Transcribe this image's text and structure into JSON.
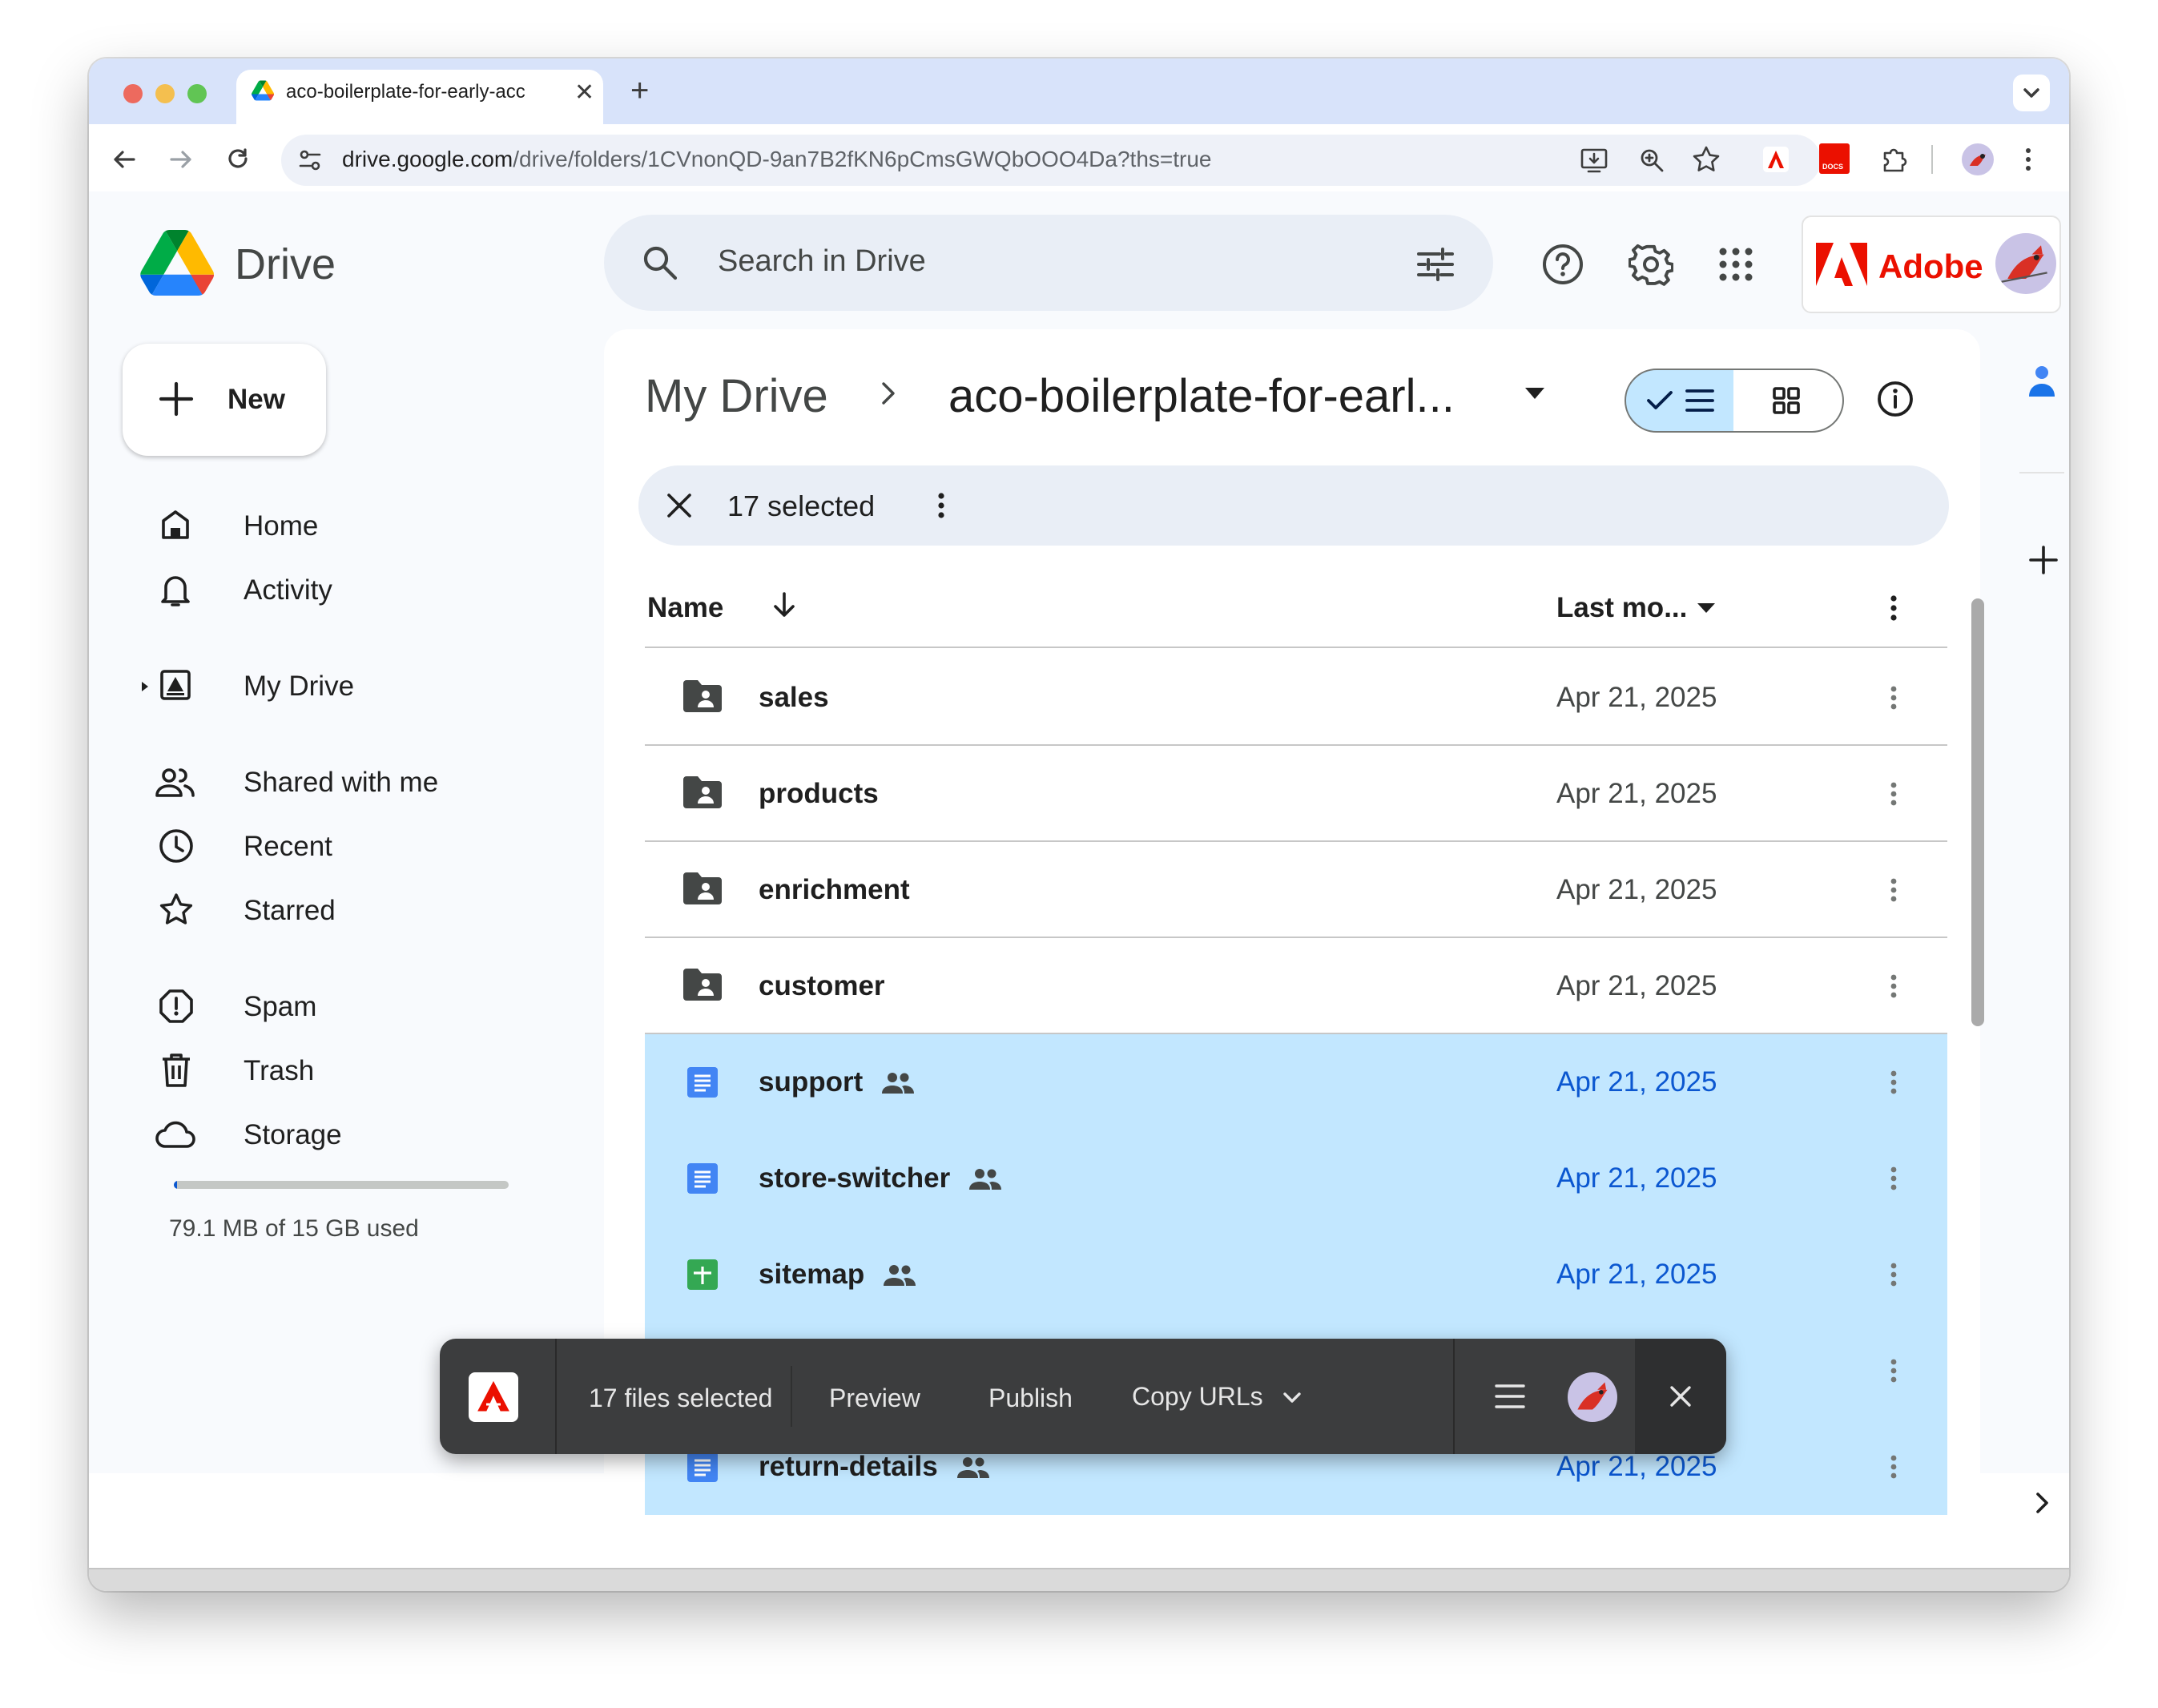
{
  "browser": {
    "tab_title": "aco-boilerplate-for-early-acc",
    "new_tab_symbol": "+",
    "url_host": "drive.google.com",
    "url_path": "/drive/folders/1CVnonQD-9an7B2fKN6pCmsGWQbOOO4Da?ths=true"
  },
  "app": {
    "name": "Drive",
    "search_placeholder": "Search in Drive",
    "adobe_label": "Adobe"
  },
  "sidebar": {
    "new_label": "New",
    "items": [
      {
        "label": "Home",
        "icon": "home-icon"
      },
      {
        "label": "Activity",
        "icon": "bell-icon"
      },
      {
        "label": "My Drive",
        "icon": "my-drive-icon"
      },
      {
        "label": "Shared with me",
        "icon": "people-icon"
      },
      {
        "label": "Recent",
        "icon": "clock-icon"
      },
      {
        "label": "Starred",
        "icon": "star-icon"
      },
      {
        "label": "Spam",
        "icon": "spam-icon"
      },
      {
        "label": "Trash",
        "icon": "trash-icon"
      },
      {
        "label": "Storage",
        "icon": "cloud-icon"
      }
    ],
    "storage_text": "79.1 MB of 15 GB used",
    "storage_fraction": 0.005
  },
  "breadcrumb": {
    "root": "My Drive",
    "separator": "›",
    "current": "aco-boilerplate-for-earl..."
  },
  "selection": {
    "count_text": "17 selected"
  },
  "table": {
    "col_name": "Name",
    "col_modified": "Last mo...",
    "rows": [
      {
        "name": "sales",
        "type": "shared-folder",
        "date": "Apr 21, 2025",
        "selected": false,
        "shared": false
      },
      {
        "name": "products",
        "type": "shared-folder",
        "date": "Apr 21, 2025",
        "selected": false,
        "shared": false
      },
      {
        "name": "enrichment",
        "type": "shared-folder",
        "date": "Apr 21, 2025",
        "selected": false,
        "shared": false
      },
      {
        "name": "customer",
        "type": "shared-folder",
        "date": "Apr 21, 2025",
        "selected": false,
        "shared": false
      },
      {
        "name": "support",
        "type": "doc",
        "date": "Apr 21, 2025",
        "selected": true,
        "shared": true
      },
      {
        "name": "store-switcher",
        "type": "doc",
        "date": "Apr 21, 2025",
        "selected": true,
        "shared": true
      },
      {
        "name": "sitemap",
        "type": "sheet",
        "date": "Apr 21, 2025",
        "selected": true,
        "shared": true
      },
      {
        "name": "",
        "type": "hidden",
        "date": "",
        "selected": true,
        "shared": false
      },
      {
        "name": "return-details",
        "type": "doc",
        "date": "Apr 21, 2025",
        "selected": true,
        "shared": true
      }
    ]
  },
  "overlay": {
    "files_selected": "17 files selected",
    "preview_label": "Preview",
    "publish_label": "Publish",
    "copy_urls_label": "Copy URLs"
  },
  "colors": {
    "selected_row": "#c2e7ff",
    "accent_blue": "#0b57d0",
    "adobe_red": "#eb1000",
    "doc_blue": "#4285f4",
    "sheet_green": "#34a853"
  }
}
